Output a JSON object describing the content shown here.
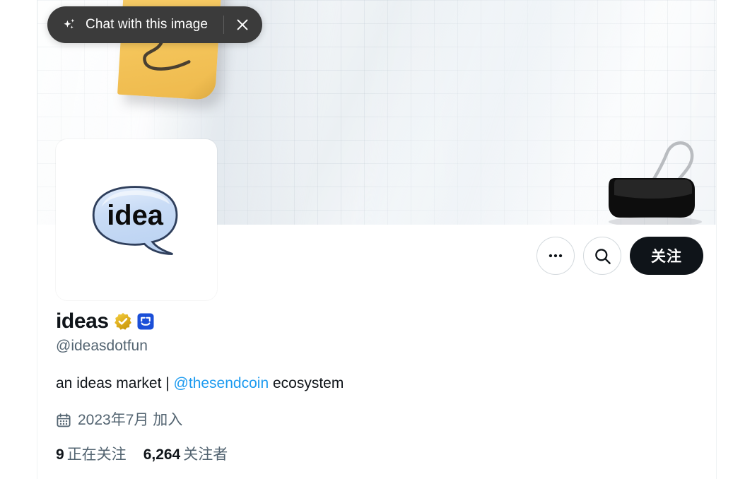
{
  "overlay": {
    "chat_pill": {
      "label": "Chat with this image",
      "sparkle_icon": "sparkle-icon",
      "close_icon": "close-icon"
    }
  },
  "banner": {
    "description": "grid-paper background with yellow sticky note and black binder clip",
    "background_color": "#f7f9fa",
    "grid_line_color": "#96a5b4",
    "sticky_note_color": "#f5c65c",
    "binder_clip_color": "#111111"
  },
  "avatar": {
    "name": "idea speech bubble logo",
    "text": "idea",
    "bubble_color": "#cfe0f7",
    "background": "#ffffff"
  },
  "actions": {
    "more_label": "",
    "more_icon": "more-horizontal-icon",
    "search_icon": "search-icon",
    "follow_label": "关注",
    "follow_bg": "#0f1419",
    "follow_fg": "#ffffff"
  },
  "profile": {
    "display_name": "ideas",
    "verified_badge": "verified-gold-badge",
    "verified_badge_color": "#e2b719",
    "affiliate_badge": "affiliate-square-badge",
    "affiliate_badge_color": "#1d4ed8",
    "handle": "@ideasdotfun",
    "bio_prefix": "an ideas market | ",
    "bio_link": "@thesendcoin",
    "bio_suffix": " ecosystem",
    "link_color": "#1d9bf0",
    "joined_icon": "calendar-icon",
    "joined_text": "2023年7月 加入",
    "stats": [
      {
        "count": "9",
        "label": "正在关注"
      },
      {
        "count": "6,264",
        "label": "关注者"
      }
    ]
  }
}
